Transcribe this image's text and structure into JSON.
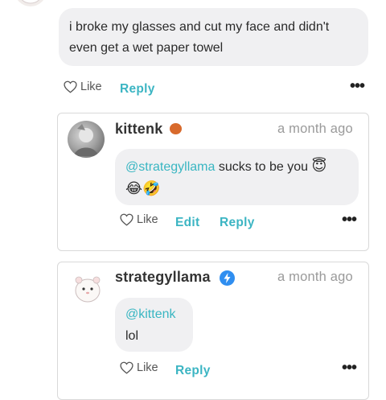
{
  "comment": {
    "text_line1": "i broke my glasses and cut my face and didn't",
    "text_line2": "even get a wet paper towel",
    "like_label": "Like",
    "reply_label": "Reply",
    "more_label": "•••"
  },
  "replies": [
    {
      "username": "kittenk",
      "time": "a month ago",
      "mention": "@strategyllama",
      "text": " sucks to be you",
      "emoji_line1": "😇",
      "emoji_line2": "😂🤣",
      "like_label": "Like",
      "edit_label": "Edit",
      "reply_label": "Reply",
      "more_label": "•••",
      "badge_icon": "speech-bubble-badge-icon"
    },
    {
      "username": "strategyllama",
      "time": "a month ago",
      "mention": "@kittenk",
      "text": "lol",
      "like_label": "Like",
      "reply_label": "Reply",
      "more_label": "•••",
      "badge_icon": "lightning-verified-badge-icon"
    }
  ],
  "colors": {
    "accent": "#3cb5c3",
    "mention": "#39b6c2",
    "bubble": "#f0f0f2",
    "badge_orange": "#d86a2c",
    "badge_blue": "#2f8ef0"
  }
}
